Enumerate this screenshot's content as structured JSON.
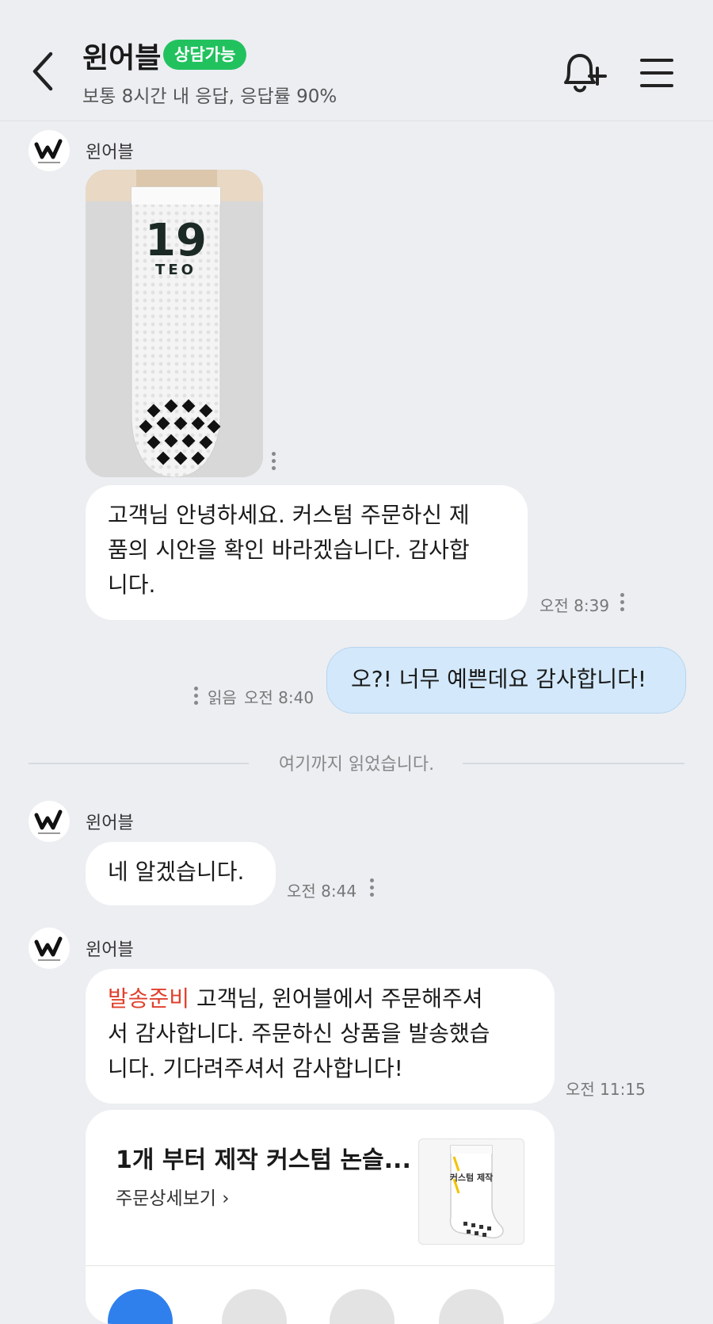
{
  "header": {
    "title": "윈어블",
    "badge": "상담가능",
    "subtitle": "보통 8시간 내 응답, 응답률 90%"
  },
  "messages": {
    "sender_name": "윈어블",
    "msg1_text": "고객님 안녕하세요. 커스텀 주문하신 제품의 시안을 확인 바라겠습니다. 감사합니다.",
    "msg1_lines": [
      "고객님 안녕하세요. 커스텀 주문하신 제",
      "품의 시안을 확인 바라겠습니다. 감사합",
      "니다."
    ],
    "msg1_time": "오전 8:39",
    "photo": {
      "number": "19",
      "name": "TEO"
    },
    "my_msg_text": "오?! 너무 예쁜데요 감사합니다!",
    "my_msg_read": "읽음",
    "my_msg_time": "오전 8:40",
    "divider": "여기까지 읽었습니다.",
    "msg2_text": "네 알겠습니다.",
    "msg2_time": "오전 8:44",
    "msg3_tag": "발송준비",
    "msg3_text_lines": [
      " 고객님, 윈어블에서 주문해주셔",
      "서 감사합니다. 주문하신 상품을 발송했습",
      "니다. 기다려주셔서 감사합니다!"
    ],
    "msg3_time": "오전 11:15"
  },
  "order_card": {
    "product_title": "1개 부터 제작 커스텀 논슬...",
    "detail_link": "주문상세보기",
    "thumb_label": "커스텀 제작"
  },
  "colors": {
    "accent_green": "#21c25e",
    "my_bubble": "#d3e9fb",
    "status_red": "#e0402e",
    "primary_blue": "#2f80ed"
  }
}
